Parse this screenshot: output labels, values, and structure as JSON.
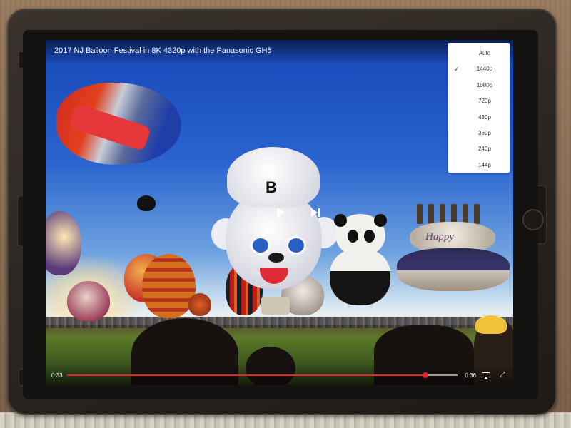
{
  "video": {
    "title": "2017 NJ Balloon Festival in 8K 4320p with the Panasonic GH5",
    "current_time": "0:33",
    "total_time": "0:36",
    "progress": 0.917
  },
  "quality_menu": {
    "options": [
      "Auto",
      "1440p",
      "1080p",
      "720p",
      "480p",
      "360p",
      "240p",
      "144p"
    ],
    "selected": "1440p"
  },
  "scene": {
    "balloon_letter": "B",
    "cake_text": "Happy"
  },
  "colors": {
    "progress_accent": "#e0272a",
    "menu_background": "#ffffff"
  },
  "icons": {
    "more": "more-vertical-icon",
    "check": "check-icon",
    "play": "play-icon",
    "next": "skip-next-icon",
    "airplay": "airplay-icon",
    "fullscreen": "fullscreen-icon"
  }
}
